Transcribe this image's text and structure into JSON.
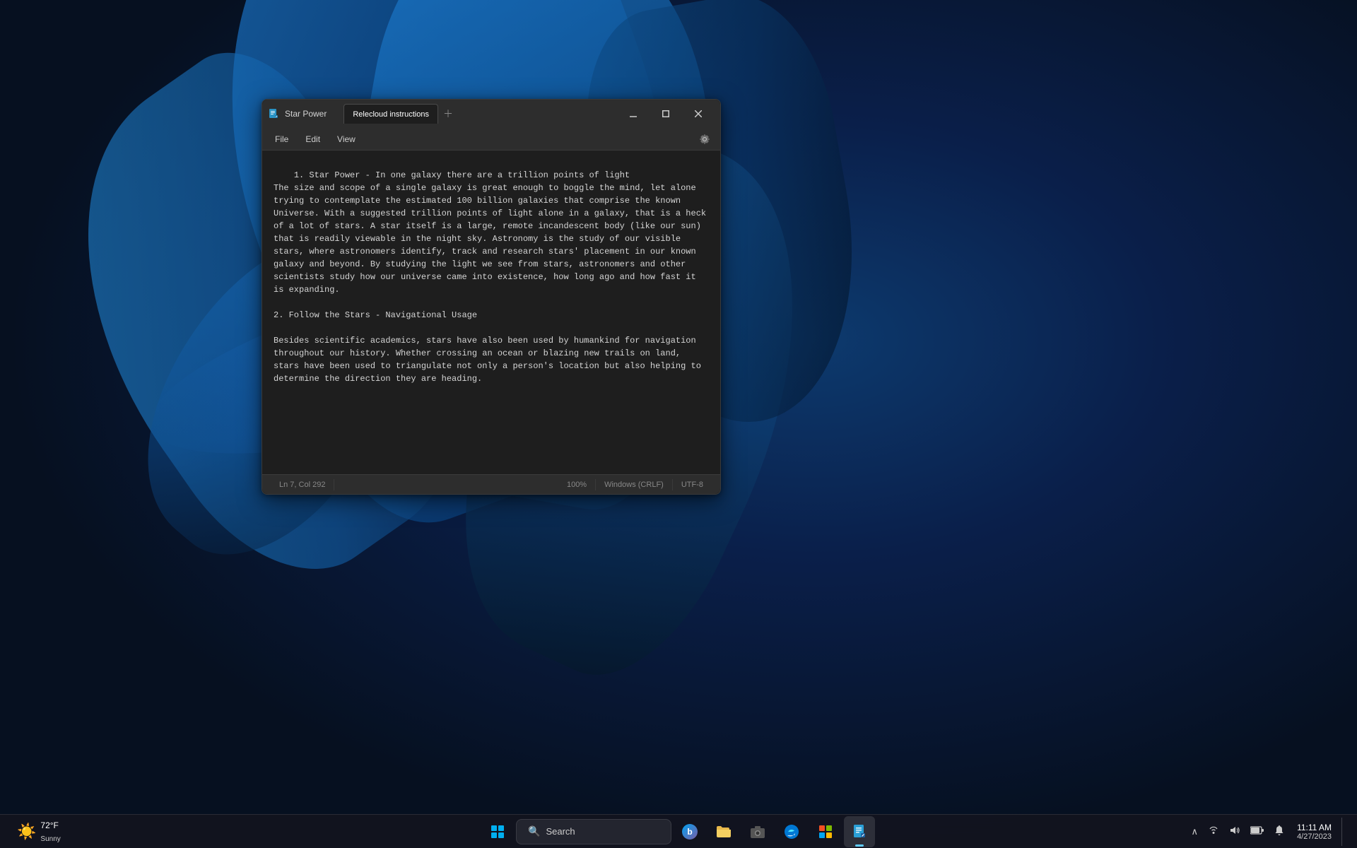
{
  "desktop": {
    "wallpaper": "windows11-bloom-blue"
  },
  "notepad": {
    "title": "Star Power",
    "tab": "Relecloud instructions",
    "menu": {
      "file": "File",
      "edit": "Edit",
      "view": "View"
    },
    "content": {
      "line1": "1. Star Power - In one galaxy there are a trillion points of light",
      "line2": "\nThe size and scope of a single galaxy is great enough to boggle the mind, let alone trying to contemplate the estimated 100 billion galaxies that comprise the known Universe. With a suggested trillion points of light alone in a galaxy, that is a heck of a lot of stars. A star itself is a large, remote incandescent body (like our sun) that is readily viewable in the night sky. Astronomy is the study of our visible stars, where astronomers identify, track and research stars' placement in our known galaxy and beyond. By studying the light we see from stars, astronomers and other scientists study how our universe came into existence, how long ago and how fast it is expanding.\n\n2. Follow the Stars - Navigational Usage\n\nBesides scientific academics, stars have also been used by humankind for navigation throughout our history. Whether crossing an ocean or blazing new trails on land, stars have been used to triangulate not only a person's location but also helping to determine the direction they are heading."
    },
    "statusbar": {
      "position": "Ln 7, Col 292",
      "zoom": "100%",
      "lineending": "Windows (CRLF)",
      "encoding": "UTF-8"
    }
  },
  "taskbar": {
    "search_placeholder": "Search",
    "weather": {
      "temp": "72°F",
      "condition": "Sunny"
    },
    "clock": {
      "time": "11:11 AM",
      "date": "4/27/2023"
    },
    "apps": [
      {
        "name": "File Explorer",
        "icon": "folder"
      },
      {
        "name": "Edge",
        "icon": "edge"
      },
      {
        "name": "Camera",
        "icon": "camera"
      },
      {
        "name": "Microsoft Store",
        "icon": "store"
      },
      {
        "name": "Notepad",
        "icon": "notepad",
        "active": true
      }
    ],
    "tray": {
      "show_hidden": "^",
      "wifi": "wifi",
      "volume": "🔊",
      "battery": "🔋",
      "notification": "notification"
    }
  }
}
